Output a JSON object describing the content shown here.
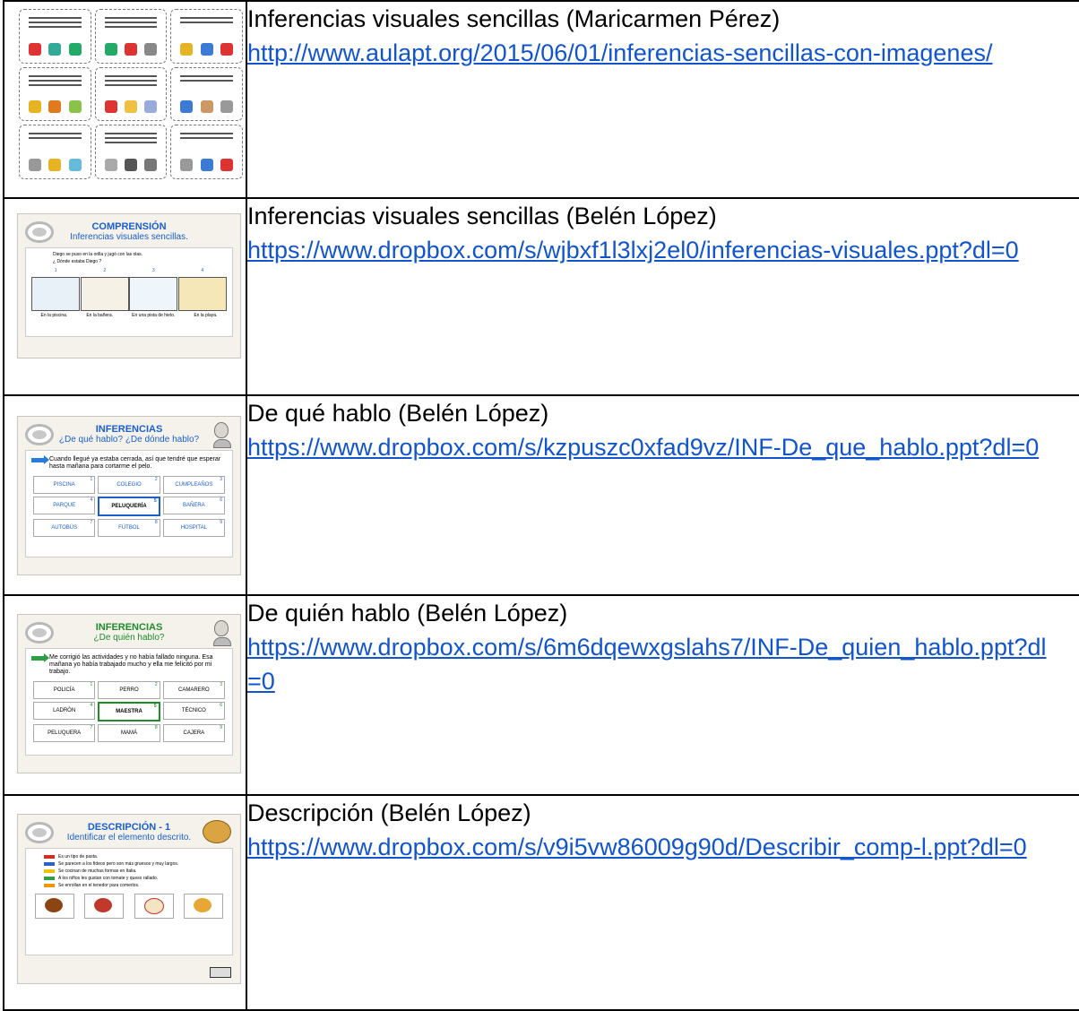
{
  "rows": [
    {
      "title": "Inferencias visuales sencillas (Maricarmen Pérez)",
      "link": "http://www.aulapt.org/2015/06/01/inferencias-sencillas-con-imagenes/",
      "thumbnail": "grid-cards"
    },
    {
      "title": "Inferencias visuales sencillas (Belén López)",
      "link": "https://www.dropbox.com/s/wjbxf1l3lxj2el0/inferencias-visuales.ppt?dl=0",
      "thumbnail": {
        "heading": "COMPRENSIÓN",
        "sub": "Inferencias visuales sencillas.",
        "q1": "Diego se puso en la orilla y jugó con las olas.",
        "q2": "¿ Dónde estaba Diego ?",
        "nums": [
          "1",
          "2",
          "3",
          "4"
        ],
        "captions": [
          "En la piscina.",
          "En la bañera.",
          "En una pista de hielo.",
          "En la playa."
        ]
      }
    },
    {
      "title": "De qué hablo (Belén López)",
      "link": "https://www.dropbox.com/s/kzpuszc0xfad9vz/INF-De_que_hablo.ppt?dl=0",
      "thumbnail": {
        "heading": "INFERENCIAS",
        "sub": "¿De qué hablo? ¿De dónde hablo?",
        "question": "Cuando llegué ya estaba cerrada, así que tendré que esperar hasta mañana para cortarme el pelo.",
        "options": [
          "PISCINA",
          "COLEGIO",
          "CUMPLEAÑOS",
          "PARQUE",
          "PELUQUERÍA",
          "BAÑERA",
          "AUTOBÚS",
          "FÚTBOL",
          "HOSPITAL"
        ],
        "selected": 4,
        "accent": "#1a5fd0"
      }
    },
    {
      "title": "De quién hablo (Belén López)",
      "link": "https://www.dropbox.com/s/6m6dqewxgslahs7/INF-De_quien_hablo.ppt?dl=0",
      "thumbnail": {
        "heading": "INFERENCIAS",
        "sub": "¿De quién hablo?",
        "question": "Me corrigió las actividades y no había fallado ninguna. Esa mañana yo había trabajado mucho y ella me felicitó por mi trabajo.",
        "options": [
          "POLICÍA",
          "PERRO",
          "CAMARERO",
          "LADRÓN",
          "MAESTRA",
          "TÉCNICO",
          "PELUQUERA",
          "MAMÁ",
          "CAJERA"
        ],
        "selected": 4,
        "accent": "#1f8c2a"
      }
    },
    {
      "title": "Descripción (Belén López)",
      "link": "https://www.dropbox.com/s/v9i5vw86009g90d/Describir_comp-l.ppt?dl=0",
      "thumbnail": {
        "heading": "DESCRIPCIÓN - 1",
        "sub": "Identificar el elemento descrito.",
        "clues": [
          "Es un tipo de pasta.",
          "Se parecen a los fideos pero son más gruesos y muy largos.",
          "Se cocinan de muchas formas en Italia.",
          "A los niños les gustan con tomate y queso rallado.",
          "Se enrollan en el tenedor para comerlos."
        ],
        "clue_colors": [
          "#d62d20",
          "#2a62c9",
          "#f2c200",
          "#2f9e44",
          "#f29500"
        ]
      }
    }
  ]
}
